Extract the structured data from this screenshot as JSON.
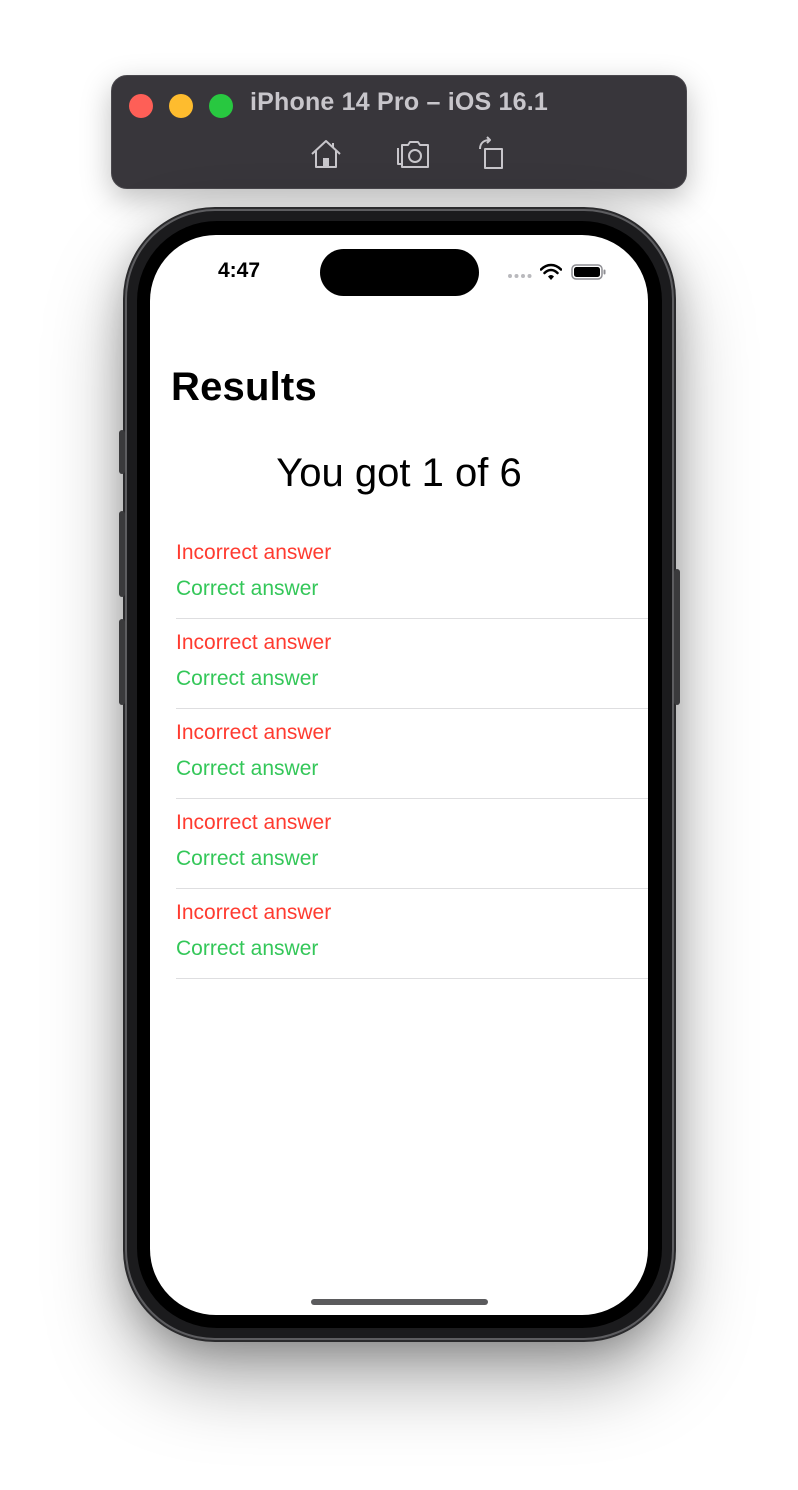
{
  "simulator": {
    "title": "iPhone 14 Pro – iOS 16.1",
    "toolbar_icons": [
      "home-icon",
      "screenshot-icon",
      "rotate-icon"
    ]
  },
  "status_bar": {
    "time": "4:47",
    "icons": [
      "cellular-signal-icon",
      "wifi-icon",
      "battery-icon"
    ]
  },
  "screen": {
    "title": "Results",
    "score_text": "You got 1 of 6",
    "results": [
      {
        "incorrect": "Incorrect answer",
        "correct": "Correct answer"
      },
      {
        "incorrect": "Incorrect answer",
        "correct": "Correct answer"
      },
      {
        "incorrect": "Incorrect answer",
        "correct": "Correct answer"
      },
      {
        "incorrect": "Incorrect answer",
        "correct": "Correct answer"
      },
      {
        "incorrect": "Incorrect answer",
        "correct": "Correct answer"
      }
    ]
  },
  "colors": {
    "incorrect": "#ff3b30",
    "correct": "#34c759",
    "title_bar": "#38363b"
  }
}
